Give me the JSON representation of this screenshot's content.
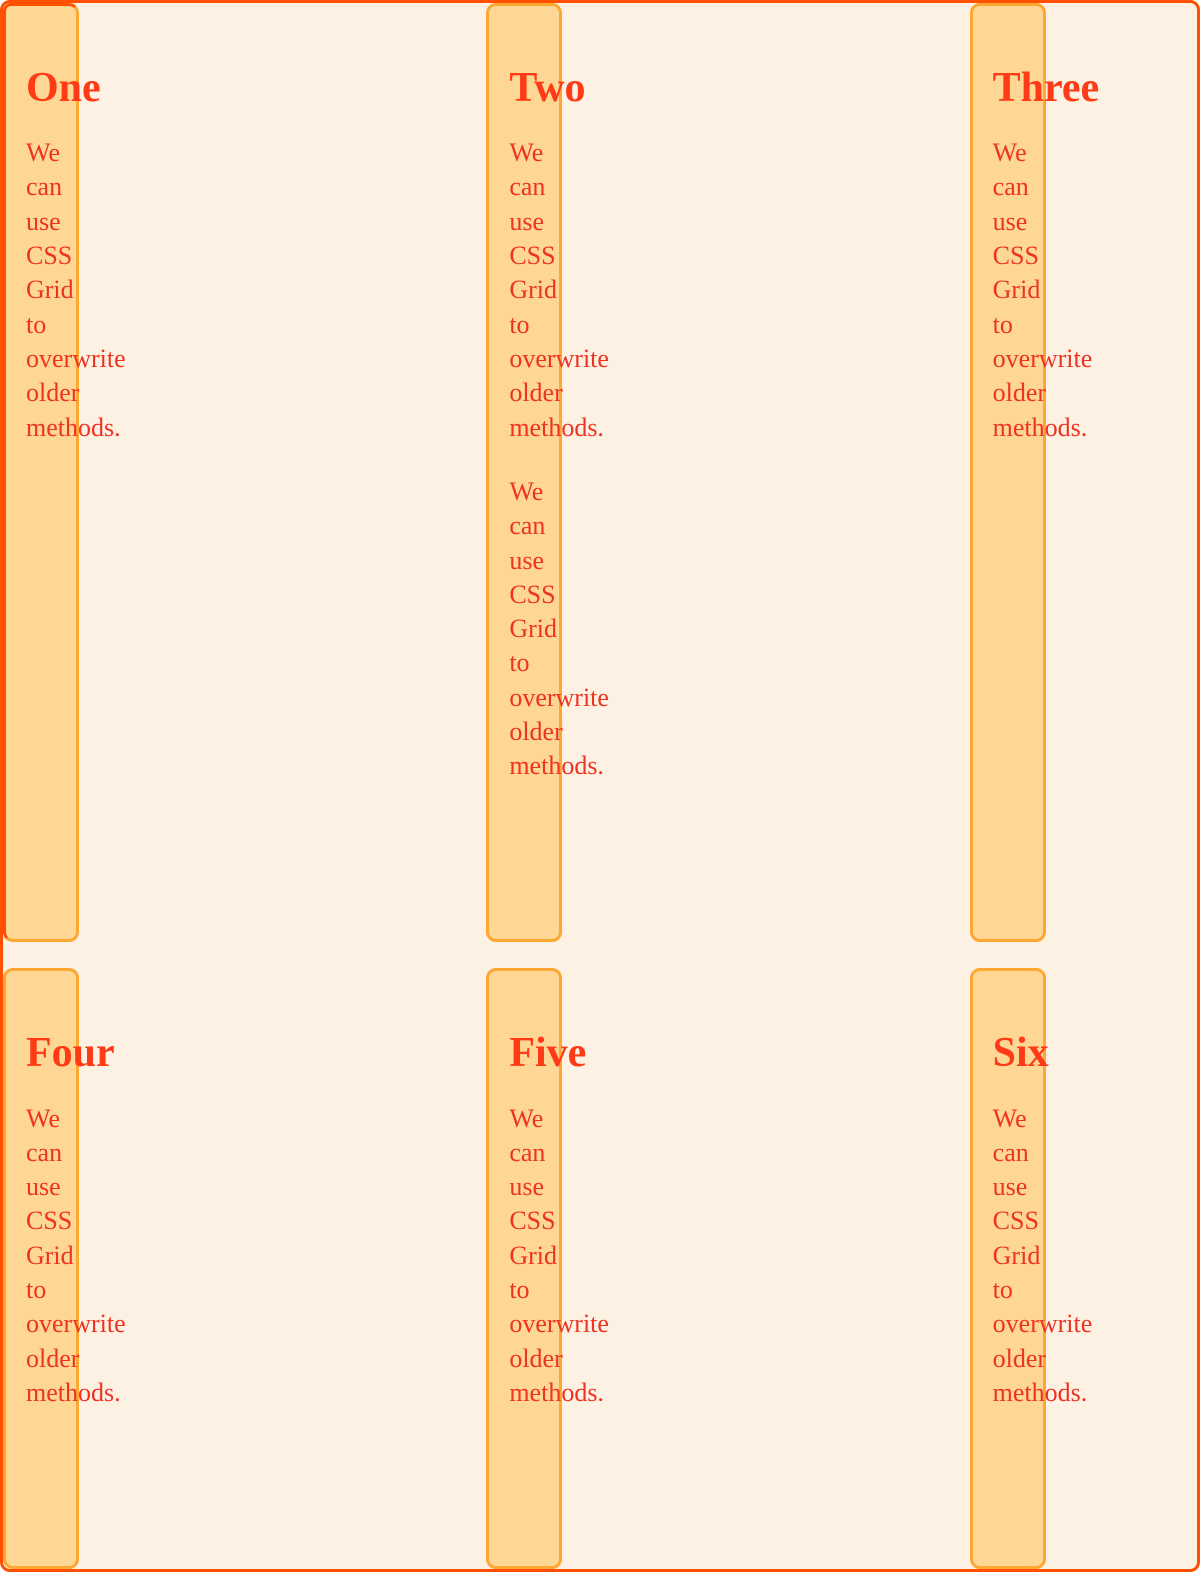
{
  "cards": [
    {
      "title": "One",
      "paras": [
        "We can use CSS Grid to overwrite older methods."
      ]
    },
    {
      "title": "Two",
      "paras": [
        "We can use CSS Grid to overwrite older methods.",
        "We can use CSS Grid to overwrite older methods."
      ]
    },
    {
      "title": "Three",
      "paras": [
        "We can use CSS Grid to overwrite older methods."
      ]
    },
    {
      "title": "Four",
      "paras": [
        "We can use CSS Grid to overwrite older methods."
      ]
    },
    {
      "title": "Five",
      "paras": [
        "We can use CSS Grid to overwrite older methods."
      ]
    },
    {
      "title": "Six",
      "paras": [
        "We can use CSS Grid to overwrite older methods."
      ]
    }
  ]
}
